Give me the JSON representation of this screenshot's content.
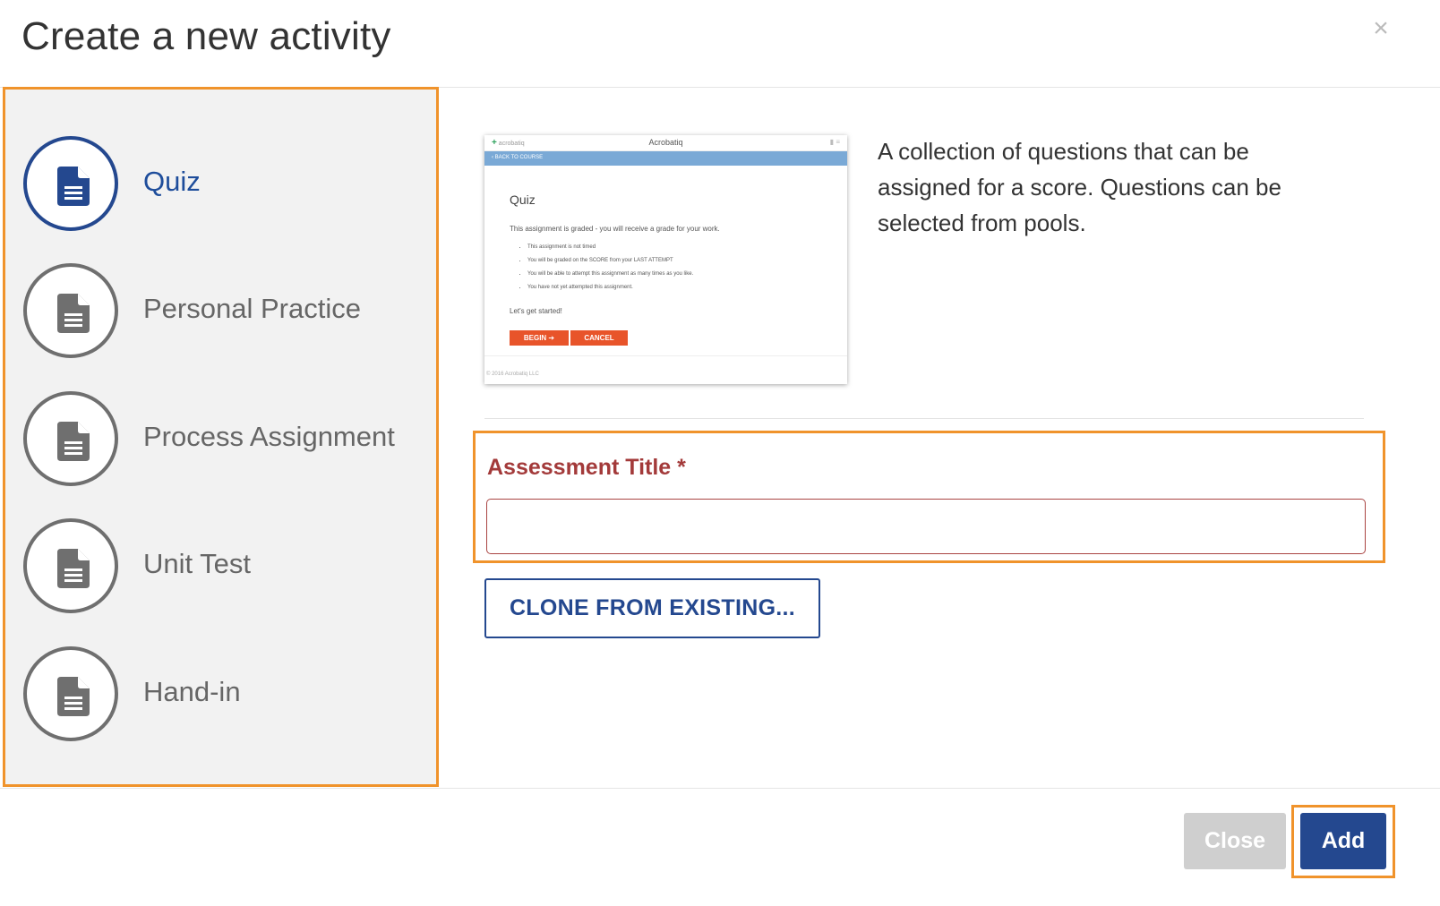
{
  "dialog": {
    "title": "Create a new activity",
    "close_icon": "×"
  },
  "activity_types": [
    {
      "label": "Quiz",
      "icon": "document-icon",
      "selected": true
    },
    {
      "label": "Personal Practice",
      "icon": "document-icon",
      "selected": false
    },
    {
      "label": "Process Assignment",
      "icon": "document-icon",
      "selected": false
    },
    {
      "label": "Unit Test",
      "icon": "document-icon",
      "selected": false
    },
    {
      "label": "Hand-in",
      "icon": "document-icon",
      "selected": false
    }
  ],
  "preview": {
    "logo": "acrobatiq",
    "app_name": "Acrobatiq",
    "back_link": "‹ BACK TO COURSE",
    "heading": "Quiz",
    "description": "This assignment is graded - you will receive a grade for your work.",
    "bullets": [
      "This assignment is not timed",
      "You will be graded on the SCORE from your LAST ATTEMPT",
      "You will be able to attempt this assignment as many times as you like.",
      "You have not yet attempted this assignment."
    ],
    "start_text": "Let's get started!",
    "begin_label": "BEGIN ➔",
    "cancel_label": "CANCEL",
    "footer": "© 2016 Acrobatiq LLC"
  },
  "description": "A collection of questions that can be assigned for a score. Questions can be selected from pools.",
  "form": {
    "title_label": "Assessment Title *",
    "title_value": "",
    "title_placeholder": ""
  },
  "clone_button": "CLONE FROM EXISTING...",
  "footer": {
    "close_label": "Close",
    "add_label": "Add"
  },
  "colors": {
    "accent_blue": "#24488f",
    "highlight_orange": "#f0932b",
    "error_red": "#a33a3a",
    "disabled_gray": "#cfcfcf"
  }
}
